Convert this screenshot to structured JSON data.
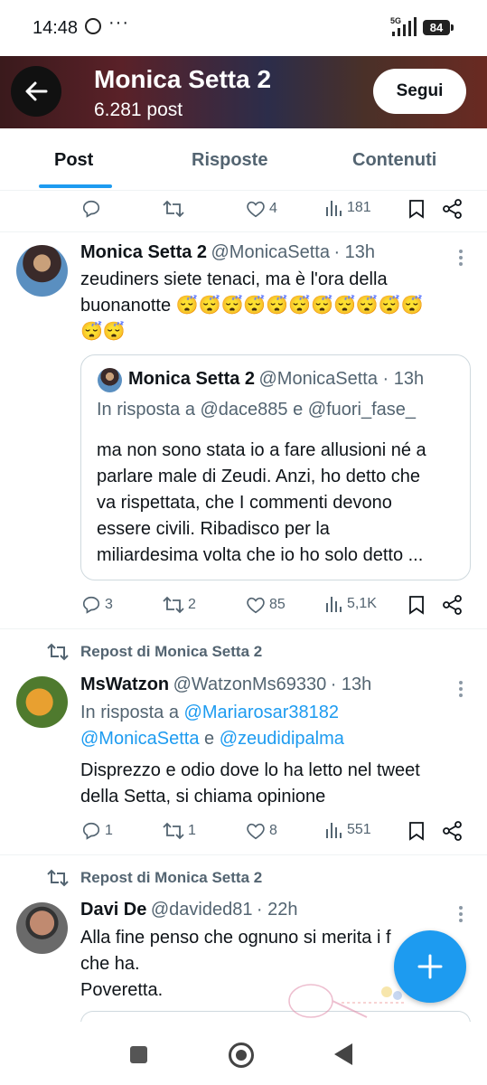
{
  "status_bar": {
    "time": "14:48",
    "network": "5G",
    "battery": "84"
  },
  "header": {
    "title": "Monica Setta 2",
    "subtitle": "6.281 post",
    "follow_label": "Segui"
  },
  "tabs": [
    {
      "label": "Post"
    },
    {
      "label": "Risposte"
    },
    {
      "label": "Contenuti"
    }
  ],
  "post0": {
    "likes": "4",
    "views": "181"
  },
  "post1": {
    "name": "Monica Setta 2",
    "handle": "@MonicaSetta",
    "time": "· 13h",
    "text_line1": "zeudiners siete tenaci, ma è l'ora della",
    "text_line2": "buonanotte 😴😴😴😴😴😴😴😴😴😴😴",
    "text_line3": "😴😴",
    "quote": {
      "name": "Monica Setta 2",
      "handle": "@MonicaSetta · 13h",
      "reply_to": "In risposta a @dace885 e @fuori_fase_",
      "lines": [
        "ma non sono stata io a fare allusioni né a",
        "parlare male di Zeudi. Anzi, ho detto che",
        "va rispettata, che I commenti devono",
        "essere civili. Ribadisco per la",
        "miliardesima volta che io ho solo detto ..."
      ]
    },
    "replies": "3",
    "reposts": "2",
    "likes": "85",
    "views": "5,1K"
  },
  "post2": {
    "repost_label": "Repost di Monica Setta 2",
    "name": "MsWatzon",
    "handle": "@WatzonMs69330",
    "time": "· 13h",
    "reply_prefix": "In risposta a ",
    "reply_user1": "@Mariarosar38182",
    "reply_user2": "@MonicaSetta",
    "reply_and": " e ",
    "reply_user3": "@zeudidipalma",
    "text_line1": "Disprezzo e odio dove lo ha letto nel tweet",
    "text_line2": "della Setta, si chiama opinione",
    "replies": "1",
    "reposts": "1",
    "likes": "8",
    "views": "551"
  },
  "post3": {
    "repost_label": "Repost di Monica Setta 2",
    "name": "Davi De",
    "handle": "@davided81",
    "time": "· 22h",
    "text_line1": "Alla fine penso che ognuno si merita i f",
    "text_line2": "che ha.",
    "text_line3": "Poveretta."
  },
  "colors": {
    "accent": "#1d9bf0",
    "text": "#0f1419",
    "secondary": "#536471"
  }
}
